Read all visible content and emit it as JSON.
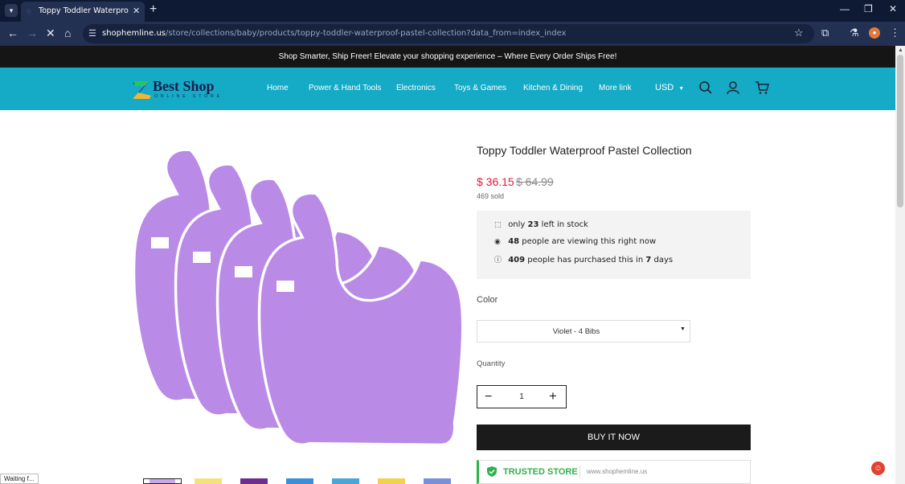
{
  "browser": {
    "tab_title": "Toppy Toddler Waterproof Pastel",
    "url_domain": "shophemline.us",
    "url_path": "/store/collections/baby/products/toppy-toddler-waterproof-pastel-collection?data_from=index_index",
    "status_text": "Waiting f..."
  },
  "announcement": "Shop Smarter, Ship Freer! Elevate your shopping experience – Where Every Order Ships Free!",
  "header": {
    "logo_text": "Best Shop",
    "logo_tagline": "ONLINE STORE",
    "nav": [
      "Home",
      "Power & Hand Tools",
      "Electronics",
      "Toys & Games",
      "Kitchen & Dining",
      "More link"
    ],
    "currency": "USD"
  },
  "product": {
    "title": "Toppy Toddler Waterproof Pastel Collection",
    "price": "$ 36.15",
    "compare_price": "$ 64.99",
    "sold": "469 sold",
    "stock": {
      "left_prefix": "only",
      "left_count": "23",
      "left_suffix": "left in stock",
      "viewing_count": "48",
      "viewing_suffix": "people are viewing this right now",
      "purchased_count": "409",
      "purchased_mid": "people has purchased this in",
      "purchased_days": "7",
      "purchased_suffix": "days"
    },
    "color_label": "Color",
    "color_value": "Violet - 4 Bibs",
    "quantity_label": "Quantity",
    "quantity": "1",
    "buy_label": "BUY IT NOW",
    "trusted_label": "TRUSTED STORE",
    "trusted_url": "www.shophemline.us",
    "bib_color": "#b98ae6",
    "thumbnail_colors": [
      "#c9a8ef",
      "#f3e27a",
      "#6b2f8f",
      "#3a8fd8",
      "#4aa6d6",
      "#f1d24a",
      "#7a8fd8"
    ]
  }
}
